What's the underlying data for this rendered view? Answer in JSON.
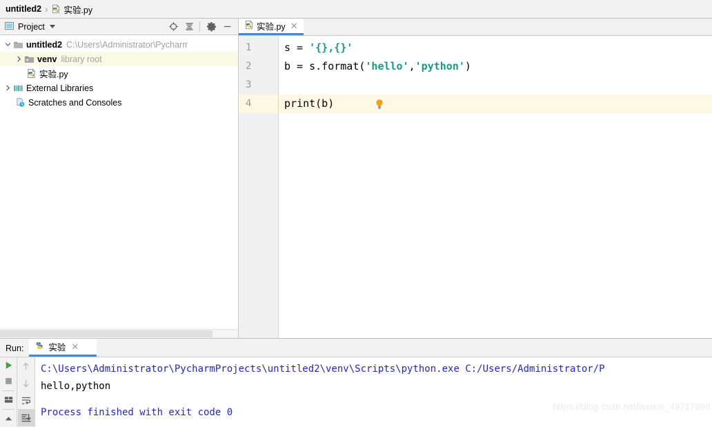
{
  "navbar": {
    "project_name": "untitled2",
    "separator": "›",
    "file_name": "实验.py",
    "file_icon": "python-file-icon"
  },
  "project_panel": {
    "title": "Project",
    "title_icon": "project-view-icon",
    "dropdown_icon": "chevron-down-icon",
    "toolbar": [
      {
        "name": "locate-icon",
        "tooltip": "Select Opened File"
      },
      {
        "name": "collapse-all-icon",
        "tooltip": "Collapse All"
      },
      {
        "name": "gear-icon",
        "tooltip": "Settings"
      },
      {
        "name": "minimize-icon",
        "tooltip": "Hide"
      }
    ],
    "tree": [
      {
        "label": "untitled2",
        "note": "C:\\Users\\Administrator\\PycharmProjects\\u",
        "icon": "folder-icon",
        "twisty": "expanded",
        "bold": true,
        "indent": 0,
        "highlighted": false
      },
      {
        "label": "venv",
        "note": "library root",
        "icon": "folder-excluded-icon",
        "twisty": "collapsed",
        "bold": true,
        "indent": 1,
        "highlighted": true
      },
      {
        "label": "实验.py",
        "note": "",
        "icon": "python-file-icon",
        "twisty": "none",
        "bold": false,
        "indent": 2,
        "highlighted": false
      },
      {
        "label": "External Libraries",
        "note": "",
        "icon": "libraries-icon",
        "twisty": "collapsed",
        "bold": false,
        "indent": 0,
        "highlighted": false
      },
      {
        "label": "Scratches and Consoles",
        "note": "",
        "icon": "scratches-icon",
        "twisty": "none",
        "bold": false,
        "indent": 0,
        "highlighted": false
      }
    ]
  },
  "editor": {
    "tab": {
      "title": "实验.py",
      "icon": "python-file-icon",
      "close_icon": "close-icon",
      "active": true
    },
    "accent_color": "#4a86c8",
    "current_line": 4,
    "line_numbers": [
      "1",
      "2",
      "3",
      "4"
    ],
    "lines": [
      {
        "number": "1",
        "tokens": [
          {
            "text": "s = ",
            "type": "plain"
          },
          {
            "text": "'{},{}'",
            "type": "string"
          }
        ]
      },
      {
        "number": "2",
        "tokens": [
          {
            "text": "b = s.format(",
            "type": "plain"
          },
          {
            "text": "'hello'",
            "type": "string"
          },
          {
            "text": ",",
            "type": "plain"
          },
          {
            "text": "'python'",
            "type": "string"
          },
          {
            "text": ")",
            "type": "plain"
          }
        ]
      },
      {
        "number": "3",
        "tokens": [],
        "bulb": true,
        "bulb_icon": "lightbulb-icon"
      },
      {
        "number": "4",
        "tokens": [
          {
            "text": "print(b)",
            "type": "plain"
          }
        ]
      }
    ],
    "string_color": "#1a9a86"
  },
  "run_panel": {
    "label": "Run:",
    "tab": {
      "title": "实验",
      "icon": "python-run-icon",
      "close_icon": "close-icon"
    },
    "tools_left": [
      {
        "name": "run-icon",
        "label": "Run",
        "active": false
      },
      {
        "name": "stop-icon",
        "label": "Stop",
        "active": false
      },
      {
        "name": "print-icon",
        "label": "Print",
        "active": false
      },
      {
        "name": "scroll-up-icon",
        "label": "Up",
        "active": false
      }
    ],
    "tools_right": [
      {
        "name": "up-arrow-icon",
        "label": "Up the Stack Trace",
        "active": false
      },
      {
        "name": "down-arrow-icon",
        "label": "Down the Stack Trace",
        "active": false
      },
      {
        "name": "soft-wrap-icon",
        "label": "Use Soft Wraps",
        "active": false
      },
      {
        "name": "scroll-to-end-icon",
        "label": "Scroll to End",
        "active": true
      }
    ],
    "output": [
      {
        "text": "C:\\Users\\Administrator\\PycharmProjects\\untitled2\\venv\\Scripts\\python.exe C:/Users/Administrator/P",
        "color": "blue"
      },
      {
        "text": "hello,python",
        "color": "black"
      },
      {
        "text": "",
        "color": "black"
      },
      {
        "text": "Process finished with exit code 0",
        "color": "blue"
      }
    ]
  },
  "watermark": {
    "text": "https://blog.csdn.net/weixin_49717998"
  }
}
